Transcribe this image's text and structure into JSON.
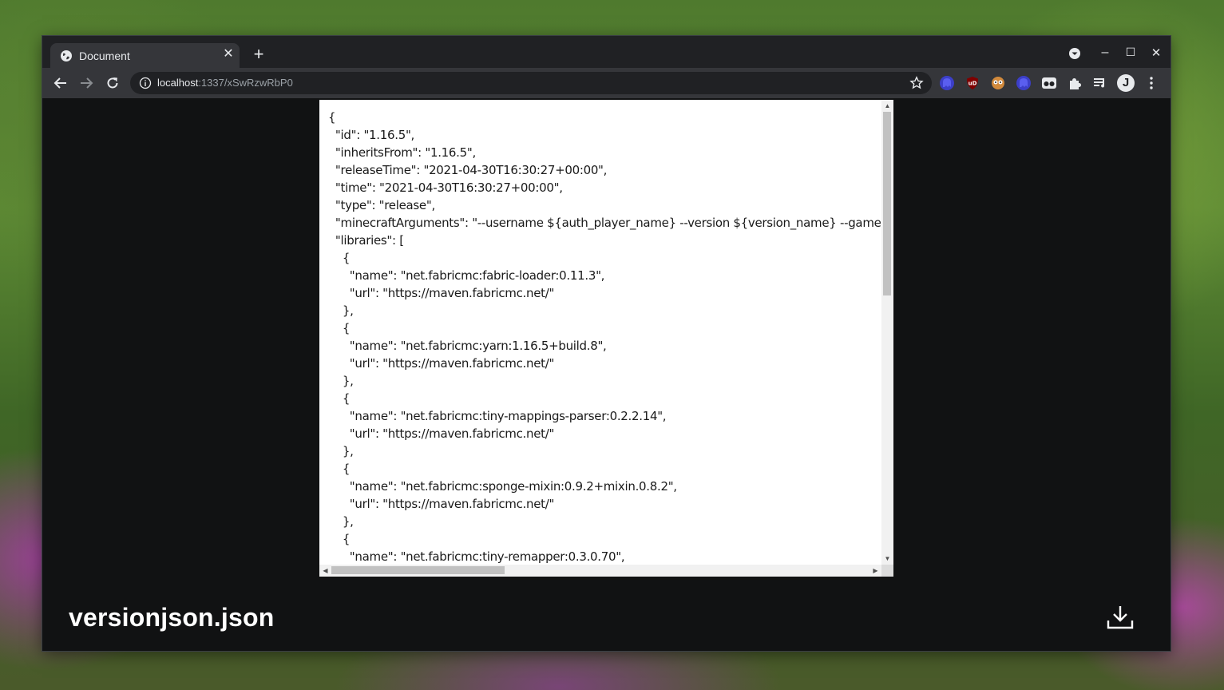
{
  "tab": {
    "title": "Document",
    "close_label": "✕",
    "new_tab_label": "+"
  },
  "window_controls": {
    "minimize": "–",
    "maximize": "☐",
    "close": "✕"
  },
  "address_bar": {
    "host": "localhost",
    "path": ":1337/xSwRzwRbP0"
  },
  "extensions": [
    {
      "name": "ghost-extension",
      "color": "#3c3fc8"
    },
    {
      "name": "ublock-origin",
      "color": "#800000",
      "label": "uD"
    },
    {
      "name": "owl-extension",
      "color": "#d28a3c"
    },
    {
      "name": "ghost-extension-2",
      "color": "#3c3fc8"
    },
    {
      "name": "goggles-extension",
      "color": "#e8eaed"
    }
  ],
  "profile": {
    "initial": "J"
  },
  "json_viewer": {
    "lines": [
      "{",
      "  \"id\": \"1.16.5\",",
      "  \"inheritsFrom\": \"1.16.5\",",
      "  \"releaseTime\": \"2021-04-30T16:30:27+00:00\",",
      "  \"time\": \"2021-04-30T16:30:27+00:00\",",
      "  \"type\": \"release\",",
      "  \"minecraftArguments\": \"--username ${auth_player_name} --version ${version_name} --gameD",
      "  \"libraries\": [",
      "    {",
      "      \"name\": \"net.fabricmc:fabric-loader:0.11.3\",",
      "      \"url\": \"https://maven.fabricmc.net/\"",
      "    },",
      "    {",
      "      \"name\": \"net.fabricmc:yarn:1.16.5+build.8\",",
      "      \"url\": \"https://maven.fabricmc.net/\"",
      "    },",
      "    {",
      "      \"name\": \"net.fabricmc:tiny-mappings-parser:0.2.2.14\",",
      "      \"url\": \"https://maven.fabricmc.net/\"",
      "    },",
      "    {",
      "      \"name\": \"net.fabricmc:sponge-mixin:0.9.2+mixin.0.8.2\",",
      "      \"url\": \"https://maven.fabricmc.net/\"",
      "    },",
      "    {",
      "      \"name\": \"net.fabricmc:tiny-remapper:0.3.0.70\","
    ]
  },
  "footer": {
    "filename": "versionjson.json"
  }
}
